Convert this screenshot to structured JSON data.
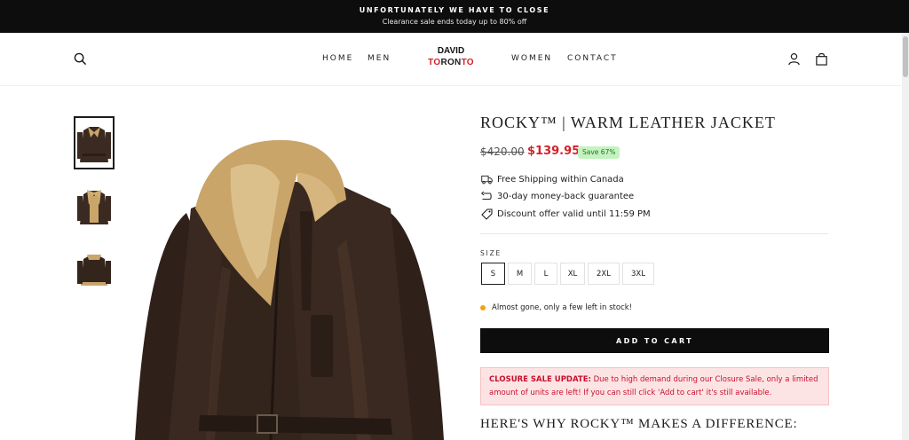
{
  "announcement": {
    "line1": "UNFORTUNATELY WE HAVE TO CLOSE",
    "line2": "Clearance sale ends today up to 80% off"
  },
  "header": {
    "nav_left": [
      "HOME",
      "MEN"
    ],
    "nav_right": [
      "WOMEN",
      "CONTACT"
    ],
    "logo": {
      "line1": "DAVID",
      "line2_red_a": "TO",
      "line2_black": "RON",
      "line2_red_b": "TO"
    },
    "icons": [
      "search-icon",
      "account-icon",
      "cart-icon"
    ]
  },
  "product": {
    "title": "ROCKY™ | WARM LEATHER JACKET",
    "price_old": "$420.00",
    "price_new": "$139.95",
    "save_badge": "Save 67%",
    "features": [
      {
        "icon": "truck-icon",
        "text": "Free Shipping within Canada"
      },
      {
        "icon": "return-icon",
        "text": "30-day money-back guarantee"
      },
      {
        "icon": "tag-icon",
        "text": "Discount offer valid until 11:59 PM"
      }
    ],
    "size_label": "SIZE",
    "sizes": [
      "S",
      "M",
      "L",
      "XL",
      "2XL",
      "3XL"
    ],
    "selected_size": "S",
    "stock_text": "Almost gone, only a few left in stock!",
    "add_to_cart": "ADD TO CART",
    "closure_title": "CLOSURE SALE UPDATE:",
    "closure_text": " Due to high demand during our Closure Sale, only a limited amount of units are left! If you can still click 'Add to cart' it's still available.",
    "why_heading": "HERE'S WHY ROCKY™ MAKES A DIFFERENCE:"
  },
  "colors": {
    "accent_red": "#d3222a",
    "save_badge_bg": "#c5f2c1",
    "closure_bg": "#fde4e4",
    "stock_dot": "#f2a40f"
  }
}
